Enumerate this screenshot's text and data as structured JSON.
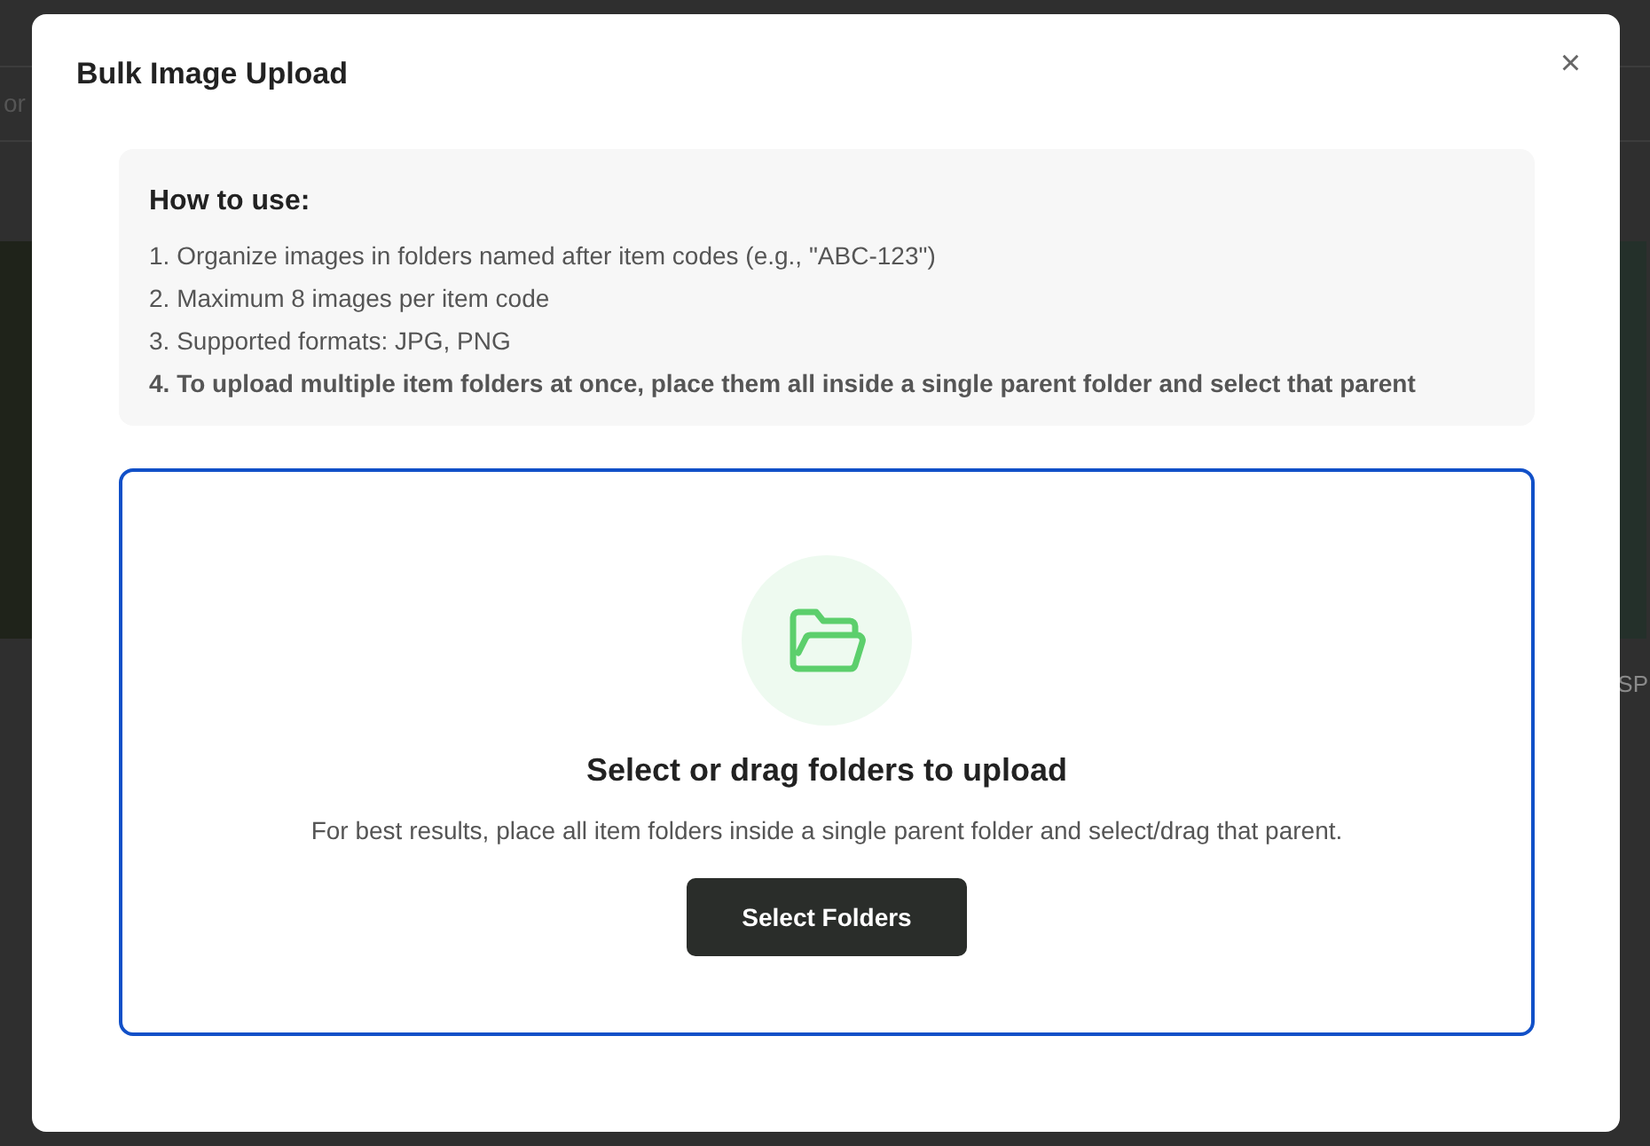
{
  "background": {
    "left_text": "or",
    "right_text": "SP"
  },
  "dialog": {
    "title": "Bulk Image Upload",
    "close": "×",
    "instructions": {
      "heading": "How to use:",
      "items": [
        {
          "text": "1. Organize images in folders named after item codes (e.g., \"ABC-123\")",
          "bold": false
        },
        {
          "text": "2. Maximum 8 images per item code",
          "bold": false
        },
        {
          "text": "3. Supported formats: JPG, PNG",
          "bold": false
        },
        {
          "text": "4. To upload multiple item folders at once, place them all inside a single parent folder and select that parent",
          "bold": true
        }
      ]
    },
    "dropzone": {
      "title": "Select or drag folders to upload",
      "hint": "For best results, place all item folders inside a single parent folder and select/drag that parent.",
      "button": "Select Folders"
    }
  }
}
